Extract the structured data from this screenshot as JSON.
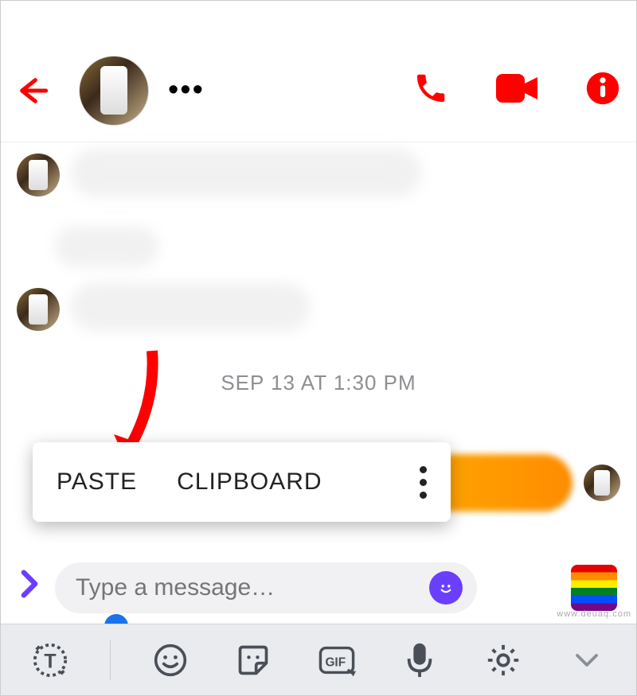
{
  "header": {
    "more_dots": "•••"
  },
  "timestamp": "SEP 13 AT 1:30 PM",
  "context_menu": {
    "paste": "PASTE",
    "clipboard": "CLIPBOARD"
  },
  "composer": {
    "placeholder": "Type a message…"
  },
  "watermark": "www.deuaq.com",
  "icons": {
    "back": "back-arrow-icon",
    "phone": "phone-icon",
    "video": "video-icon",
    "info": "info-icon",
    "text_mode": "text-mode-icon",
    "emoji": "emoji-icon",
    "sticker": "sticker-icon",
    "gif": "gif-icon",
    "mic": "mic-icon",
    "settings": "gear-icon",
    "collapse": "chevron-down-icon",
    "expand": "chevron-right-icon",
    "smile": "smile-icon",
    "rainbow": "rainbow-flag-icon"
  }
}
